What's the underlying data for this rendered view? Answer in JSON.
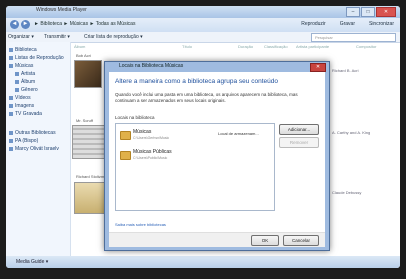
{
  "window": {
    "title": "Windows Media Player",
    "controls": [
      "–",
      "□",
      "✕"
    ]
  },
  "address": {
    "crumbs": "► Biblioteca ► Músicas ► Todas as Músicas",
    "right_buttons": [
      "Reproduzir",
      "Gravar",
      "Sincronizar"
    ]
  },
  "toolbar": {
    "organize": "Organizar ▾",
    "stream": "Transmitir ▾",
    "create_list": "Criar lista de reprodução ▾",
    "search_placeholder": "Pesquisar"
  },
  "columns": {
    "album": "Álbum",
    "title": "Título",
    "duration": "Duração",
    "rating": "Classificação",
    "artist": "Artista participante",
    "composer": "Compositor"
  },
  "sidebar": {
    "items": [
      "Biblioteca",
      "Listas de Reprodução",
      "Músicas",
      "Artista",
      "Álbum",
      "Gênero",
      "Vídeos",
      "Imagens",
      "TV Gravada",
      "Outras Bibliotecas",
      "PA (Bispo)",
      "Marcy Olivát Israelv"
    ]
  },
  "albums": {
    "a1": "Bob Acri",
    "a2": "Mr. Scruff",
    "a3": "Richard Stoltzman"
  },
  "right_column": {
    "r1": "Richard B. Acri",
    "r2": "A. Carthy and A. King",
    "r3": "Claude Debussy"
  },
  "bottom": {
    "media_guide": "Media Guide ▾"
  },
  "dialog": {
    "title": "Locais na Biblioteca Músicas",
    "heading": "Altere a maneira como a biblioteca agrupa seu conteúdo",
    "description": "Quando você inclui uma pasta em uma biblioteca, os arquivos aparecem na biblioteca, mas continuam a ser armazenados em seus locais originais.",
    "locations_label": "Locais na biblioteca",
    "locations": [
      {
        "name": "Músicas",
        "path": "C:\\Users\\Gerhsn\\Music",
        "note": "Local de armazenam..."
      },
      {
        "name": "Músicas Públicas",
        "path": "C:\\Users\\Public\\Music",
        "note": ""
      }
    ],
    "add_button": "Adicionar...",
    "remove_button": "Remover",
    "learn_link": "Saiba mais sobre bibliotecas",
    "ok_button": "OK",
    "cancel_button": "Cancelar"
  }
}
